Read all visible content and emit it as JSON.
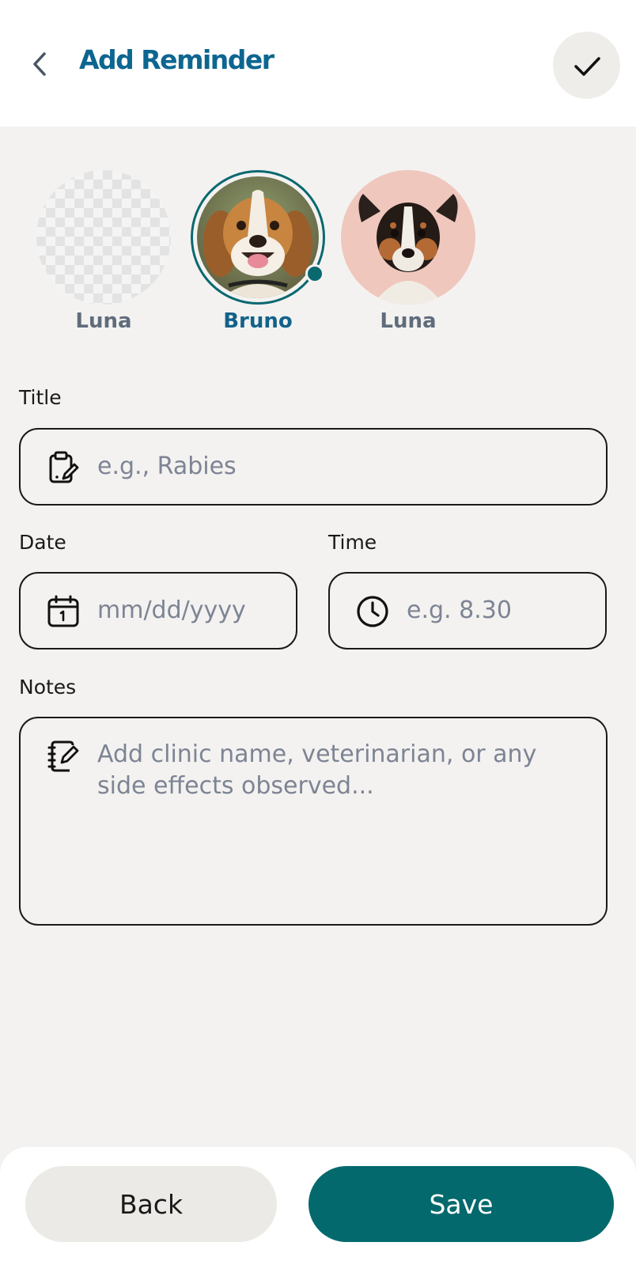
{
  "header": {
    "title": "Add Reminder",
    "back_icon": "chevron-left-icon",
    "confirm_icon": "check-icon"
  },
  "pets": [
    {
      "name": "Luna",
      "selected": false,
      "avatar": "transparent-placeholder"
    },
    {
      "name": "Bruno",
      "selected": true,
      "avatar": "beagle-photo"
    },
    {
      "name": "Luna",
      "selected": false,
      "avatar": "terrier-photo"
    }
  ],
  "form": {
    "title_label": "Title",
    "title_placeholder": "e.g., Rabies",
    "date_label": "Date",
    "date_placeholder": "mm/dd/yyyy",
    "time_label": "Time",
    "time_placeholder": "e.g. 8.30",
    "notes_label": "Notes",
    "notes_placeholder": "Add clinic name, veterinarian, or any side effects observed..."
  },
  "footer": {
    "back_label": "Back",
    "save_label": "Save"
  },
  "colors": {
    "accent": "#0d6690",
    "primary_button": "#03696c",
    "background": "#f3f2f0"
  }
}
